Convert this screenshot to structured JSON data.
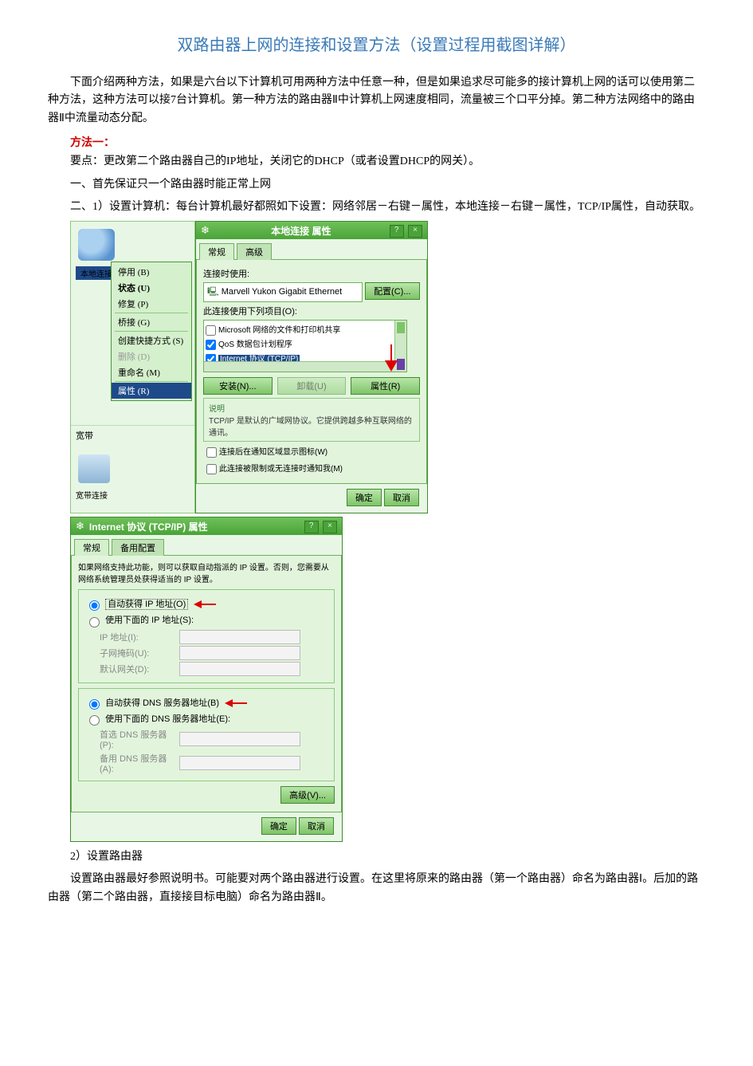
{
  "title": "双路由器上网的连接和设置方法（设置过程用截图详解）",
  "intro": "下面介绍两种方法，如果是六台以下计算机可用两种方法中任意一种，但是如果追求尽可能多的接计算机上网的话可以使用第二种方法，这种方法可以接7台计算机。第一种方法的路由器Ⅱ中计算机上网速度相同，流量被三个口平分掉。第二种方法网络中的路由器Ⅱ中流量动态分配。",
  "method1_title": "方法一：",
  "point_label": "要点：更改第二个路由器自己的IP地址，关闭它的DHCP（或者设置DHCP的网关）。",
  "step1": "一、首先保证只一个路由器时能正常上网",
  "step2": "二、1）设置计算机：每台计算机最好都照如下设置：网络邻居－右键－属性，本地连接－右键－属性，TCP/IP属性，自动获取。",
  "footer1": "2）设置路由器",
  "footer2": "设置路由器最好参照说明书。可能要对两个路由器进行设置。在这里将原来的路由器（第一个路由器）命名为路由器Ⅰ。后加的路由器（第二个路由器，直接接目标电脑）命名为路由器Ⅱ。",
  "ctx": {
    "local_conn_label": "本地连接",
    "broadband_section": "宽带",
    "broadband_conn": "宽带连接",
    "menu": {
      "disable": "停用 (B)",
      "status": "状态 (U)",
      "repair": "修复 (P)",
      "bridge": "桥接 (G)",
      "shortcut": "创建快捷方式 (S)",
      "delete": "删除 (D)",
      "rename": "重命名 (M)",
      "properties": "属性 (R)"
    }
  },
  "win1": {
    "title": "本地连接 属性",
    "tab_general": "常规",
    "tab_advanced": "高级",
    "connect_using": "连接时使用:",
    "adapter": "Marvell Yukon Gigabit Ethernet",
    "configure_btn": "配置(C)...",
    "items_label": "此连接使用下列项目(O):",
    "item_ms": "Microsoft 网络的文件和打印机共享",
    "item_qos": "QoS 数据包计划程序",
    "item_tcpip": "Internet 协议 (TCP/IP)",
    "install_btn": "安装(N)...",
    "uninstall_btn": "卸载(U)",
    "properties_btn": "属性(R)",
    "desc_title": "说明",
    "desc_text": "TCP/IP 是默认的广域网协议。它提供跨越多种互联网络的通讯。",
    "chk_notify": "连接后在通知区域显示图标(W)",
    "chk_limited": "此连接被限制或无连接时通知我(M)",
    "ok": "确定",
    "cancel": "取消"
  },
  "win2": {
    "title": "Internet 协议 (TCP/IP) 属性",
    "tab_general": "常规",
    "tab_alt": "备用配置",
    "hint": "如果网络支持此功能，则可以获取自动指派的 IP 设置。否则，您需要从网络系统管理员处获得适当的 IP 设置。",
    "radio_auto_ip": "自动获得 IP 地址(O)",
    "radio_manual_ip": "使用下面的 IP 地址(S):",
    "ip_label": "IP 地址(I):",
    "mask_label": "子网掩码(U):",
    "gw_label": "默认网关(D):",
    "radio_auto_dns": "自动获得 DNS 服务器地址(B)",
    "radio_manual_dns": "使用下面的 DNS 服务器地址(E):",
    "dns1_label": "首选 DNS 服务器(P):",
    "dns2_label": "备用 DNS 服务器(A):",
    "advanced_btn": "高级(V)...",
    "ok": "确定",
    "cancel": "取消"
  }
}
